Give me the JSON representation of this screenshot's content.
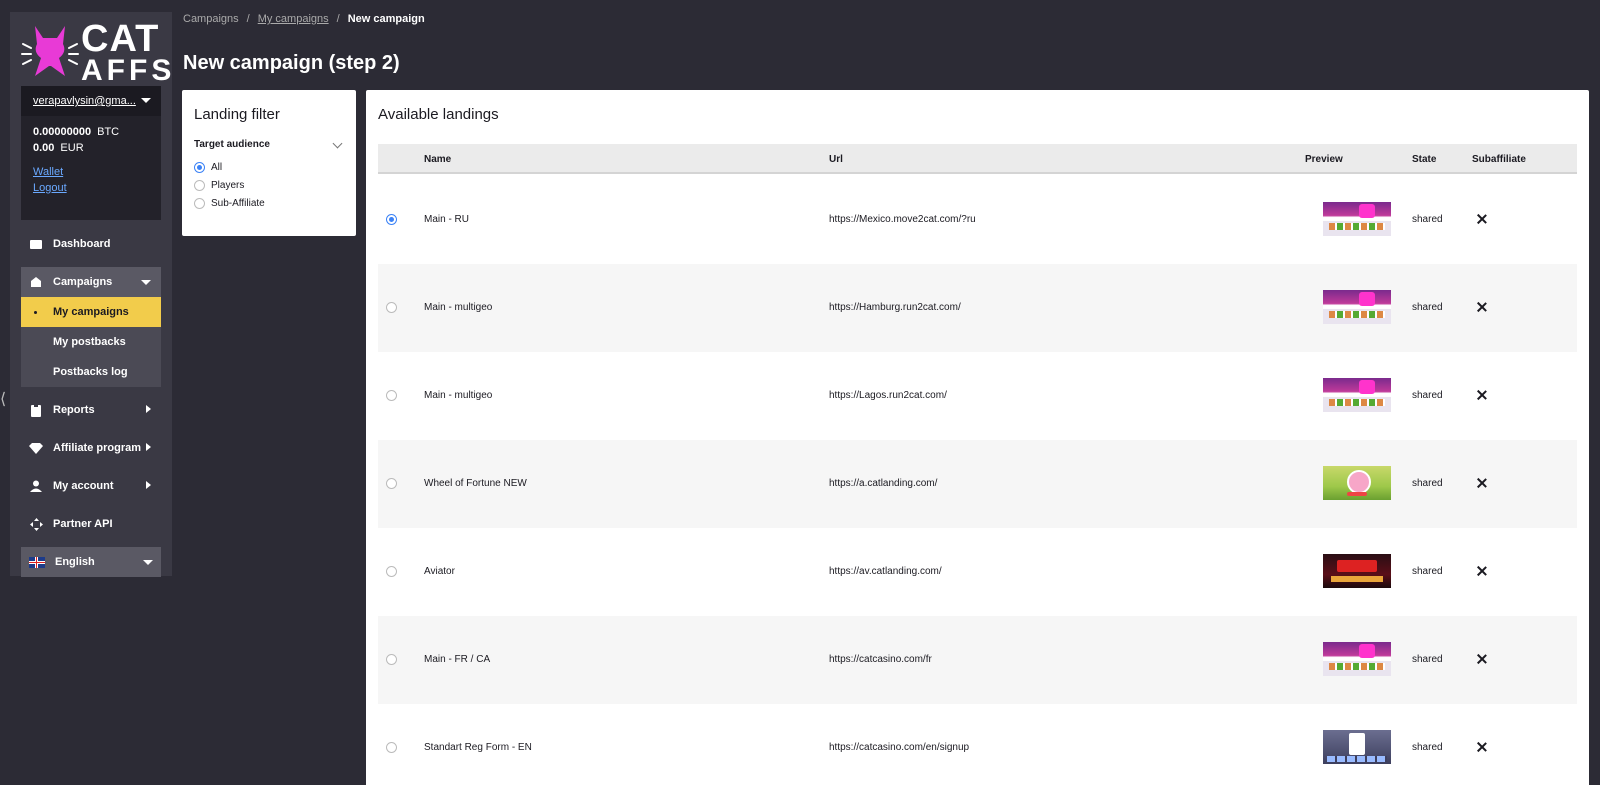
{
  "logo": {
    "line1": "CAT",
    "line2": "AFFS",
    "accent": "#e83ad6"
  },
  "user": {
    "email": "verapavlysin@gma...",
    "balances": [
      {
        "amount": "0.00000000",
        "currency": "BTC"
      },
      {
        "amount": "0.00",
        "currency": "EUR"
      }
    ],
    "wallet_label": "Wallet",
    "logout_label": "Logout"
  },
  "nav": {
    "dashboard": "Dashboard",
    "campaigns": "Campaigns",
    "my_campaigns": "My campaigns",
    "my_postbacks": "My postbacks",
    "postbacks_log": "Postbacks log",
    "reports": "Reports",
    "affiliate_program": "Affiliate program",
    "my_account": "My account",
    "partner_api": "Partner API",
    "language": "English"
  },
  "breadcrumb": {
    "root": "Campaigns",
    "sep": "/",
    "parent": "My campaigns",
    "current": "New campaign"
  },
  "page_title": "New campaign (step 2)",
  "filter": {
    "title": "Landing filter",
    "group_label": "Target audience",
    "options": [
      "All",
      "Players",
      "Sub-Affiliate"
    ],
    "selected": "All"
  },
  "landings": {
    "title": "Available landings",
    "columns": {
      "name": "Name",
      "url": "Url",
      "preview": "Preview",
      "state": "State",
      "subaffiliate": "Subaffiliate"
    },
    "rows": [
      {
        "name": "Main - RU",
        "url": "https://Mexico.move2cat.com/?ru",
        "state": "shared",
        "preview": "casino-preview",
        "selected": true
      },
      {
        "name": "Main - multigeo",
        "url": "https://Hamburg.run2cat.com/",
        "state": "shared",
        "preview": "casino-preview",
        "selected": false
      },
      {
        "name": "Main - multigeo",
        "url": "https://Lagos.run2cat.com/",
        "state": "shared",
        "preview": "casino-preview",
        "selected": false
      },
      {
        "name": "Wheel of Fortune NEW",
        "url": "https://a.catlanding.com/",
        "state": "shared",
        "preview": "wheel-preview",
        "selected": false
      },
      {
        "name": "Aviator",
        "url": "https://av.catlanding.com/",
        "state": "shared",
        "preview": "aviator-preview",
        "selected": false
      },
      {
        "name": "Main - FR / CA",
        "url": "https://catcasino.com/fr",
        "state": "shared",
        "preview": "casino-preview",
        "selected": false
      },
      {
        "name": "Standart Reg Form - EN",
        "url": "https://catcasino.com/en/signup",
        "state": "shared",
        "preview": "regform-preview",
        "selected": false
      }
    ]
  },
  "colors": {
    "background": "#2c2b35",
    "sidebar": "#3a3944",
    "active": "#f2cc4b",
    "link": "#6aa9ff",
    "radio": "#3b82f6"
  }
}
